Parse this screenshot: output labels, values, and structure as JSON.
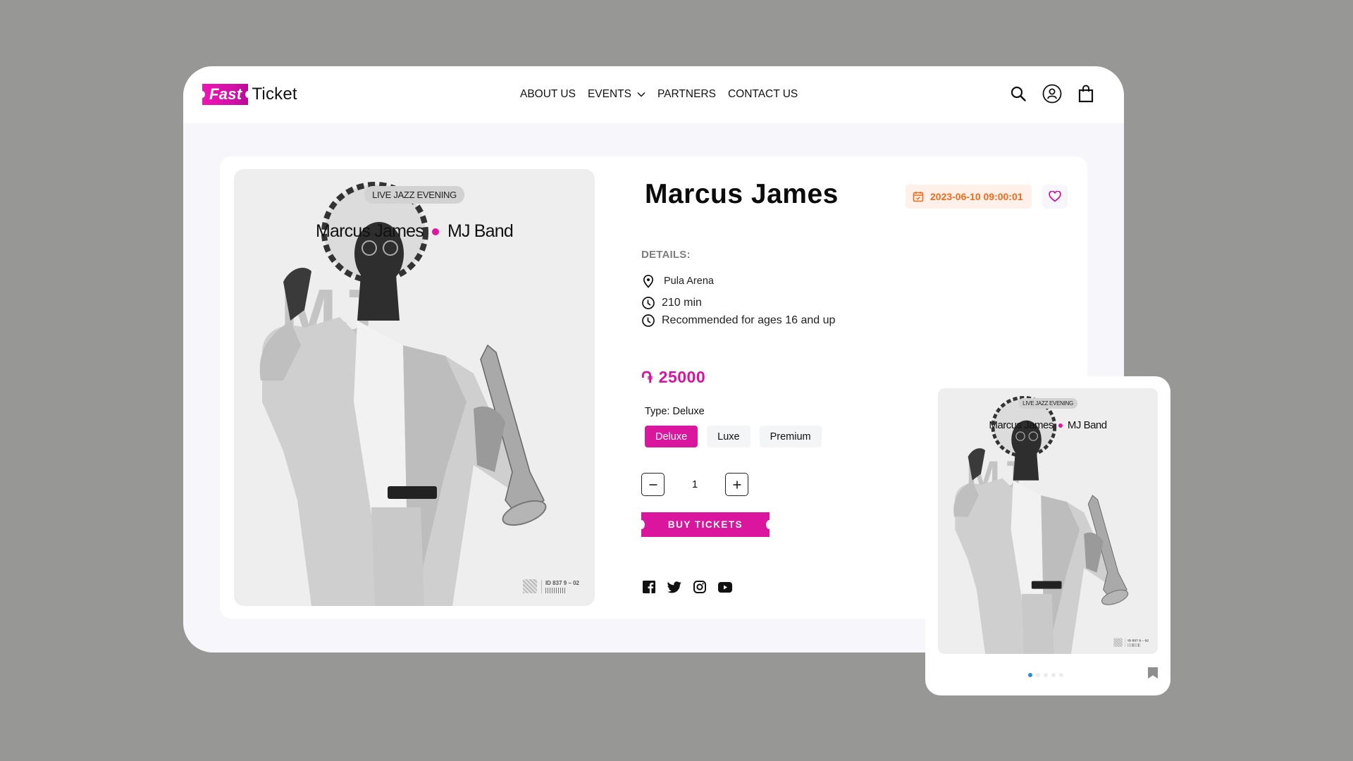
{
  "brand": {
    "logo_part1": "Fast",
    "logo_part2": "Ticket",
    "accent": "#da169f"
  },
  "nav": {
    "items": [
      {
        "label": "ABOUT US"
      },
      {
        "label": "EVENTS",
        "has_dropdown": true
      },
      {
        "label": "PARTNERS"
      },
      {
        "label": "CONTACT US"
      }
    ],
    "icons": [
      "search-icon",
      "account-icon",
      "shopping-bag-icon"
    ]
  },
  "poster": {
    "tag": "LIVE JAZZ EVENING",
    "artist": "Marcus James",
    "band": "MJ Band",
    "initials": "MJ",
    "ticket_id": "ID 837 9 – 02"
  },
  "event": {
    "title": "Marcus James",
    "date": "2023-06-10 09:00:01",
    "details_label": "DETAILS:",
    "venue": "Pula Arena",
    "duration": "210 min",
    "age": "Recommended for ages 16 and up",
    "currency_symbol": "֏",
    "price": "25000",
    "type_label": "Type: Deluxe",
    "types": [
      {
        "label": "Deluxe",
        "selected": true
      },
      {
        "label": "Luxe",
        "selected": false
      },
      {
        "label": "Premium",
        "selected": false
      }
    ],
    "quantity": "1",
    "buy_label": "BUY TICKETS"
  },
  "socials": [
    "facebook-icon",
    "twitter-icon",
    "instagram-icon",
    "youtube-icon"
  ],
  "mobile_preview": {
    "carousel_pages": 5,
    "active_page": 1
  }
}
